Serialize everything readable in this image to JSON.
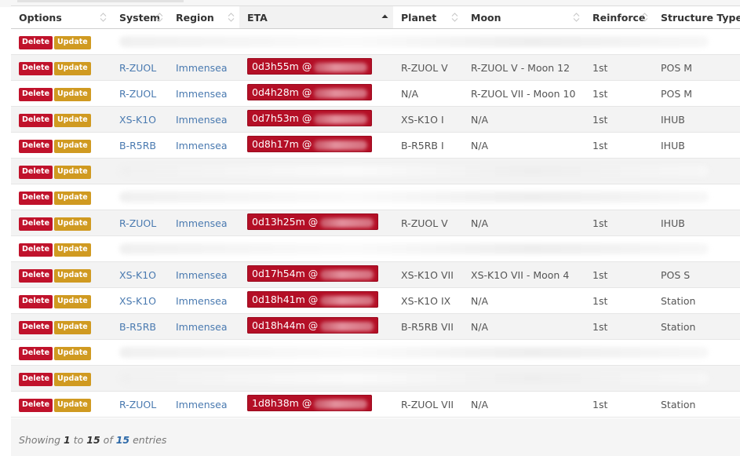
{
  "columns": [
    {
      "label": "Options",
      "sort": "both"
    },
    {
      "label": "System",
      "sort": "both"
    },
    {
      "label": "Region",
      "sort": "both"
    },
    {
      "label": "ETA",
      "sort": "asc"
    },
    {
      "label": "Planet",
      "sort": "both"
    },
    {
      "label": "Moon",
      "sort": "both"
    },
    {
      "label": "Reinforce",
      "sort": "both"
    },
    {
      "label": "Structure Type",
      "sort": "none"
    }
  ],
  "buttons": {
    "delete": "Delete",
    "update": "Update"
  },
  "rows": [
    {
      "blurred": true
    },
    {
      "blurred": false,
      "system": "R-ZUOL",
      "region": "Immensea",
      "eta": "0d3h55m @",
      "planet": "R-ZUOL V",
      "moon": "R-ZUOL V - Moon 12",
      "reinforce": "1st",
      "structure": "POS M"
    },
    {
      "blurred": false,
      "system": "R-ZUOL",
      "region": "Immensea",
      "eta": "0d4h28m @",
      "planet": "N/A",
      "moon": "R-ZUOL VII - Moon 10",
      "reinforce": "1st",
      "structure": "POS M"
    },
    {
      "blurred": false,
      "system": "XS-K1O",
      "region": "Immensea",
      "eta": "0d7h53m @",
      "planet": "XS-K1O I",
      "moon": "N/A",
      "reinforce": "1st",
      "structure": "IHUB"
    },
    {
      "blurred": false,
      "system": "B-R5RB",
      "region": "Immensea",
      "eta": "0d8h17m @",
      "planet": "B-R5RB I",
      "moon": "N/A",
      "reinforce": "1st",
      "structure": "IHUB"
    },
    {
      "blurred": true
    },
    {
      "blurred": true
    },
    {
      "blurred": false,
      "system": "R-ZUOL",
      "region": "Immensea",
      "eta": "0d13h25m @",
      "planet": "R-ZUOL V",
      "moon": "N/A",
      "reinforce": "1st",
      "structure": "IHUB"
    },
    {
      "blurred": true
    },
    {
      "blurred": false,
      "system": "XS-K1O",
      "region": "Immensea",
      "eta": "0d17h54m @",
      "planet": "XS-K1O VII",
      "moon": "XS-K1O VII - Moon 4",
      "reinforce": "1st",
      "structure": "POS S"
    },
    {
      "blurred": false,
      "system": "XS-K1O",
      "region": "Immensea",
      "eta": "0d18h41m @",
      "planet": "XS-K1O IX",
      "moon": "N/A",
      "reinforce": "1st",
      "structure": "Station"
    },
    {
      "blurred": false,
      "system": "B-R5RB",
      "region": "Immensea",
      "eta": "0d18h44m @",
      "planet": "B-R5RB VII",
      "moon": "N/A",
      "reinforce": "1st",
      "structure": "Station"
    },
    {
      "blurred": true
    },
    {
      "blurred": true
    },
    {
      "blurred": false,
      "system": "R-ZUOL",
      "region": "Immensea",
      "eta": "1d8h38m @",
      "planet": "R-ZUOL VII",
      "moon": "N/A",
      "reinforce": "1st",
      "structure": "Station"
    }
  ],
  "footer": {
    "prefix": "Showing",
    "start": "1",
    "to": "to",
    "end": "15",
    "of": "of",
    "total": "15",
    "suffix": "entries"
  },
  "colors": {
    "delete": "#c0122b",
    "update": "#d09a21",
    "eta": "#b40f26",
    "link": "#4a7ab0"
  }
}
